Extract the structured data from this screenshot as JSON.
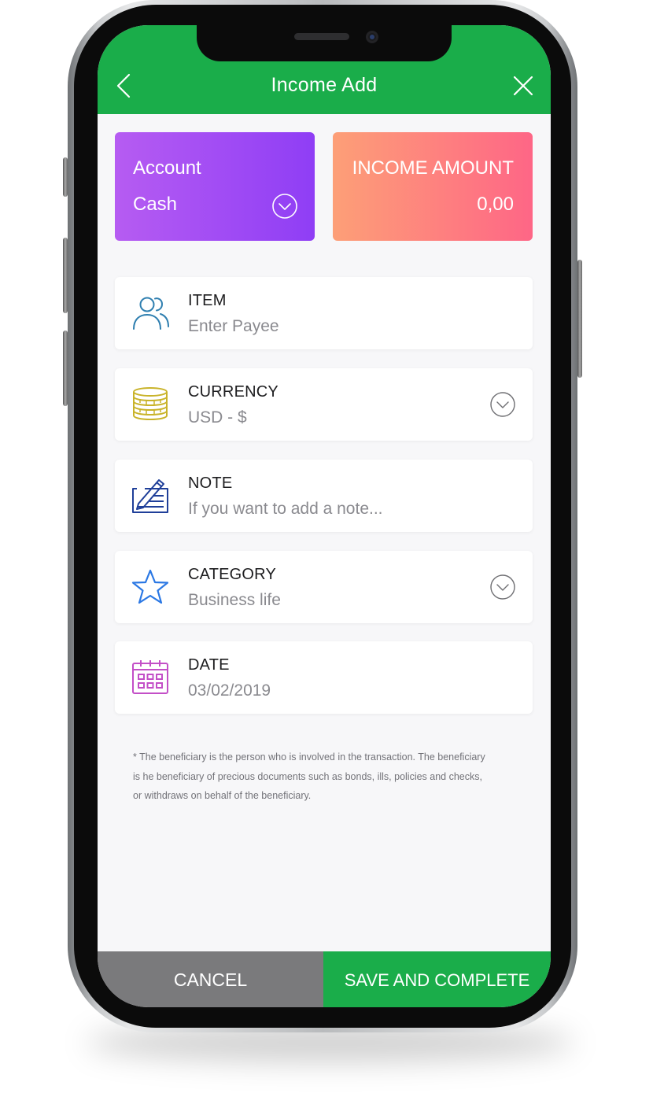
{
  "header": {
    "title": "Income Add",
    "back_icon": "chevron-left-icon",
    "close_icon": "close-icon",
    "color": "#1aad4a"
  },
  "account_card": {
    "label": "Account",
    "value": "Cash",
    "icon": "chevron-down-circle-icon",
    "gradient": [
      "#b65cf2",
      "#8f3ef5"
    ]
  },
  "income_card": {
    "label": "INCOME AMOUNT",
    "value": "0,00",
    "gradient": [
      "#fd9f77",
      "#fe6686"
    ]
  },
  "fields": [
    {
      "label": "ITEM",
      "value": "Enter Payee",
      "icon": "users-icon",
      "icon_color": "#2f7fb0",
      "dropdown": false
    },
    {
      "label": "CURRENCY",
      "value": "USD - $",
      "icon": "coins-icon",
      "icon_color": "#c9b32a",
      "dropdown": true
    },
    {
      "label": "NOTE",
      "value": "If you want to add a note...",
      "icon": "note-pen-icon",
      "icon_color": "#1f3f99",
      "dropdown": false
    },
    {
      "label": "CATEGORY",
      "value": "Business life",
      "icon": "star-icon",
      "icon_color": "#2b78e4",
      "dropdown": true
    },
    {
      "label": "DATE",
      "value": "03/02/2019",
      "icon": "calendar-icon",
      "icon_color": "#c34fc7",
      "dropdown": false
    }
  ],
  "footnote": {
    "line1": "* The beneficiary is the person who is involved in the transaction. The beneficiary",
    "line2": " is he beneficiary of precious documents such as bonds, ills, policies and checks,",
    "line3": "or withdraws on behalf of the beneficiary."
  },
  "actions": {
    "cancel_label": "CANCEL",
    "save_label": "SAVE AND COMPLETE",
    "cancel_color": "#7a7a7c",
    "save_color": "#1aad4a"
  }
}
